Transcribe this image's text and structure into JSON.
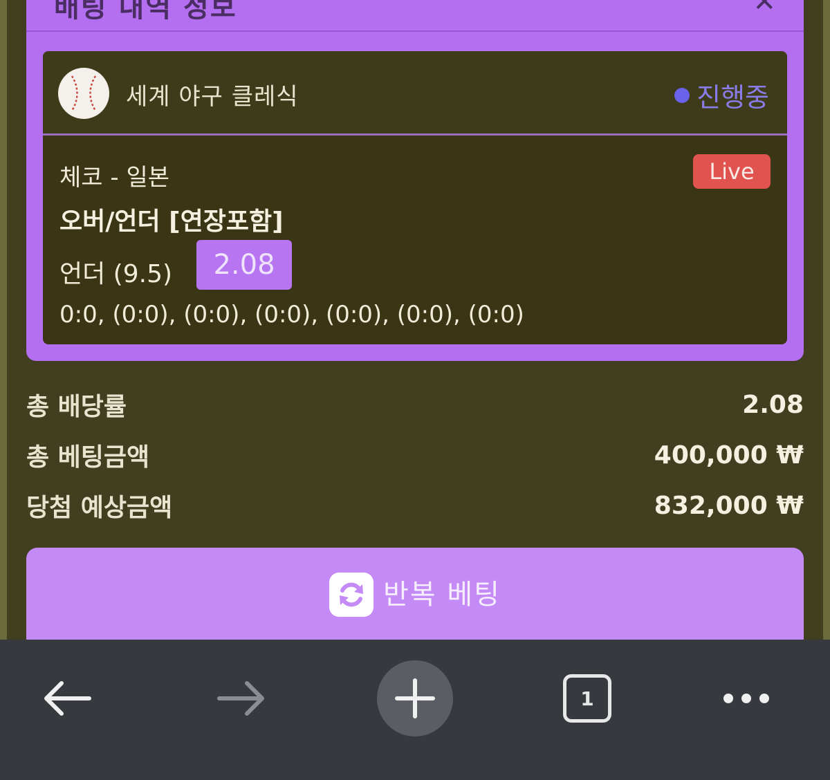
{
  "modal": {
    "title": "배팅 내역 정보",
    "close": "✕"
  },
  "game": {
    "league": "세계 야구 클레식",
    "status": "진행중",
    "teams": "체코 - 일본",
    "live_badge": "Live",
    "market": "오버/언더 [연장포함]",
    "pick": "언더 (9.5)",
    "odds": "2.08",
    "score": "0:0, (0:0), (0:0), (0:0), (0:0), (0:0), (0:0)"
  },
  "summary": {
    "total_odds_label": "총 배당률",
    "total_odds_value": "2.08",
    "total_bet_label": "총 베팅금액",
    "total_bet_value": "400,000 ₩",
    "expected_win_label": "당첨 예상금액",
    "expected_win_value": "832,000 ₩"
  },
  "repeat_button": {
    "label": "반복 베팅",
    "icon": "refresh-icon"
  },
  "browser_bar": {
    "back_icon": "back-arrow-icon",
    "forward_icon": "forward-arrow-icon",
    "new_tab_icon": "plus-icon",
    "tab_count": "1",
    "menu_icon": "more-icon"
  },
  "colors": {
    "background": "#413f20",
    "purple": "#b46ff0",
    "live": "#e0534f",
    "status": "#6a62ea"
  }
}
